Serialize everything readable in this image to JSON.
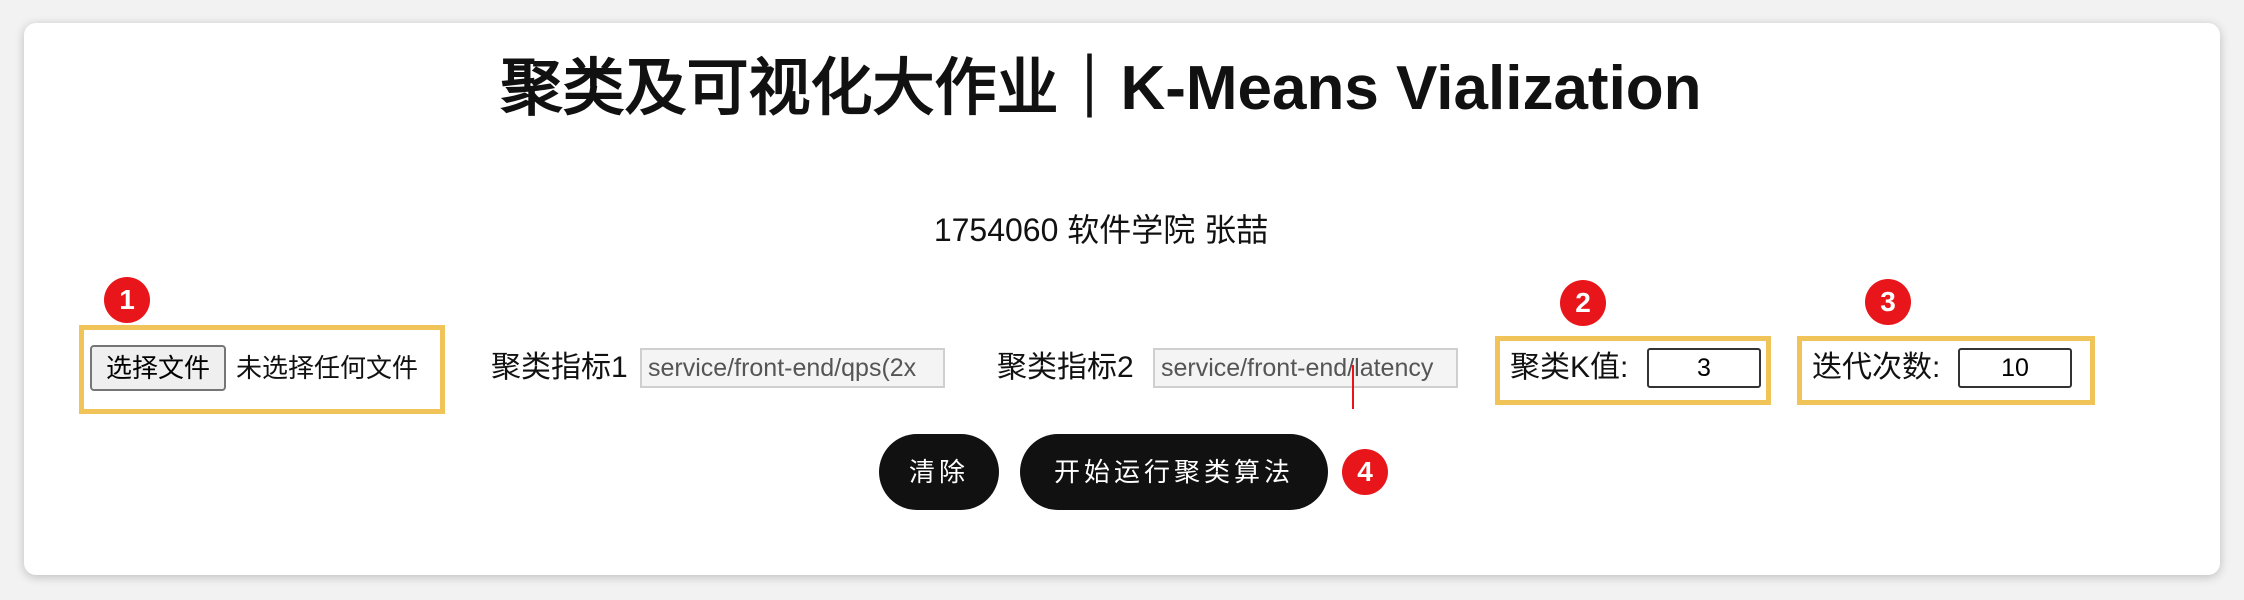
{
  "title": "聚类及可视化大作业｜K-Means Vialization",
  "subtitle": "1754060 软件学院 张喆",
  "file_picker": {
    "button_label": "选择文件",
    "status": "未选择任何文件"
  },
  "metric1": {
    "label": "聚类指标1",
    "value": "service/front-end/qps(2x"
  },
  "metric2": {
    "label": "聚类指标2",
    "value": "service/front-end/latency"
  },
  "k": {
    "label": "聚类K值:",
    "value": "3"
  },
  "iterations": {
    "label": "迭代次数:",
    "value": "10"
  },
  "buttons": {
    "clear": "清除",
    "run": "开始运行聚类算法"
  },
  "annotations": [
    "1",
    "2",
    "3",
    "4"
  ],
  "colors": {
    "highlight_border": "#f1c45a",
    "annotation_badge": "#e8161b",
    "primary_button": "#111111"
  }
}
